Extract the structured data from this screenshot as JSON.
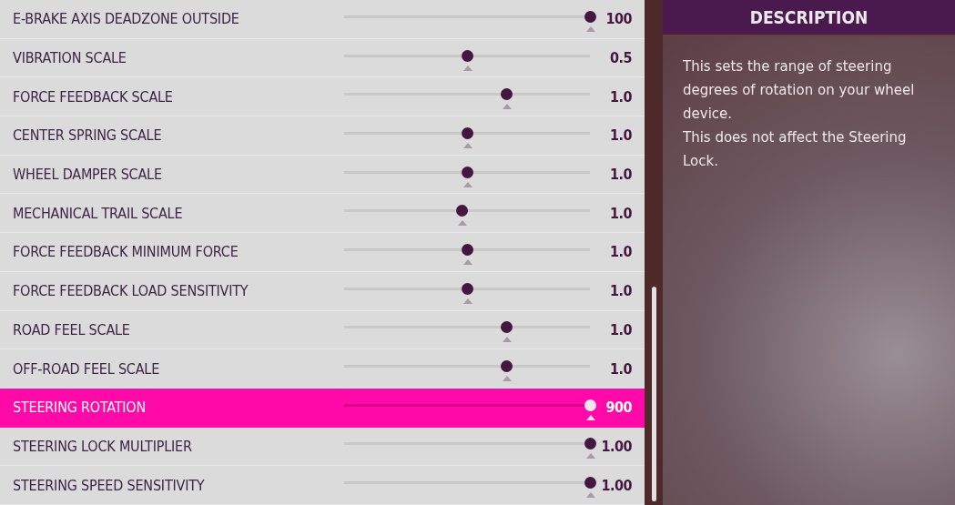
{
  "settings": [
    {
      "label": "E-BRAKE AXIS DEADZONE OUTSIDE",
      "value": "100",
      "level": 1,
      "selected": false
    },
    {
      "label": "VIBRATION SCALE",
      "value": "0.5",
      "level": 0.5,
      "selected": false
    },
    {
      "label": "FORCE FEEDBACK SCALE",
      "value": "1.0",
      "level": 0.66,
      "selected": false
    },
    {
      "label": "CENTER SPRING SCALE",
      "value": "1.0",
      "level": 0.5,
      "selected": false
    },
    {
      "label": "WHEEL DAMPER SCALE",
      "value": "1.0",
      "level": 0.5,
      "selected": false
    },
    {
      "label": "MECHANICAL TRAIL SCALE",
      "value": "1.0",
      "level": 0.48,
      "selected": false
    },
    {
      "label": "FORCE FEEDBACK MINIMUM FORCE",
      "value": "1.0",
      "level": 0.5,
      "selected": false
    },
    {
      "label": "FORCE FEEDBACK LOAD SENSITIVITY",
      "value": "1.0",
      "level": 0.5,
      "selected": false
    },
    {
      "label": "ROAD FEEL SCALE",
      "value": "1.0",
      "level": 0.66,
      "selected": false
    },
    {
      "label": "OFF-ROAD FEEL SCALE",
      "value": "1.0",
      "level": 0.66,
      "selected": false
    },
    {
      "label": "STEERING ROTATION",
      "value": "900",
      "level": 1,
      "selected": true
    },
    {
      "label": "STEERING LOCK MULTIPLIER",
      "value": "1.00",
      "level": 1,
      "selected": false
    },
    {
      "label": "STEERING SPEED SENSITIVITY",
      "value": "1.00",
      "level": 1,
      "selected": false
    }
  ],
  "description": {
    "title": "DESCRIPTION",
    "paragraphs": [
      "This sets the range of steering degrees of rotation on your wheel device.",
      "This does not affect the Steering Lock."
    ]
  }
}
